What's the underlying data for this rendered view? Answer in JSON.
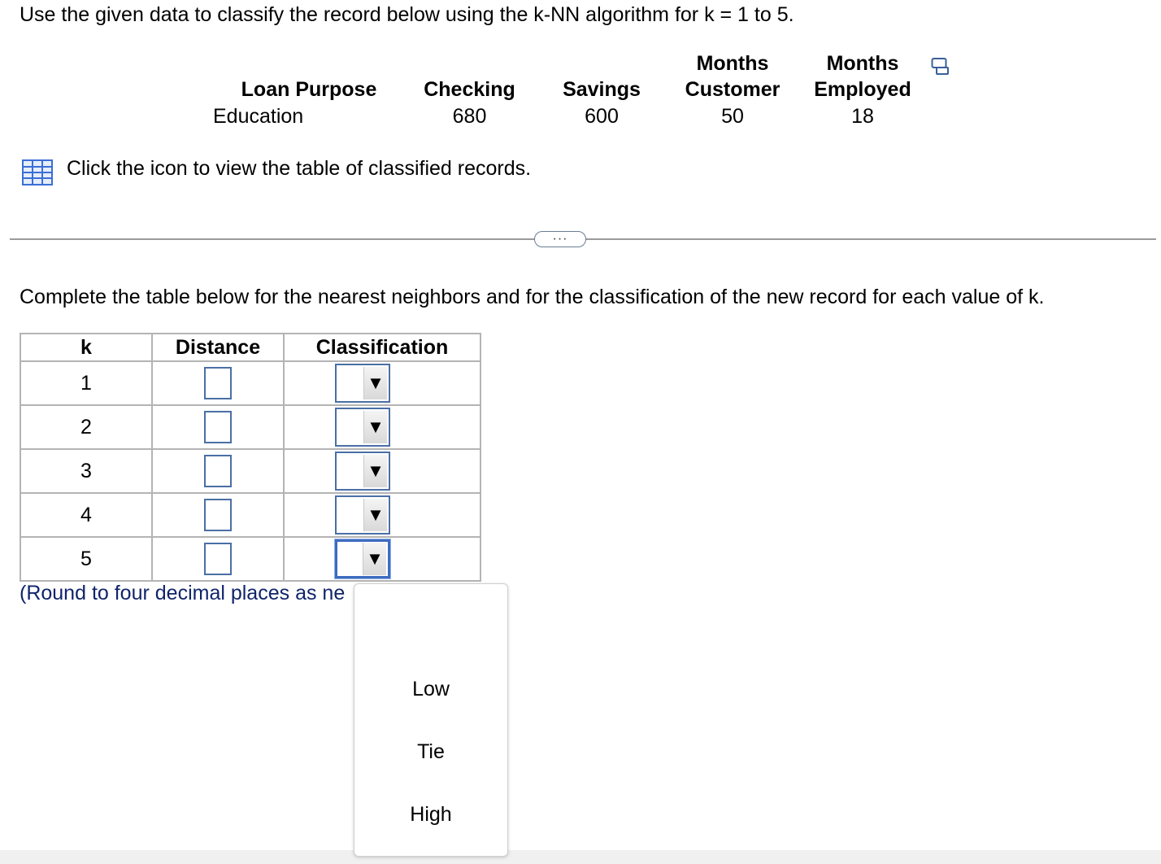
{
  "instruction": "Use the given data to classify the record below using the k-NN algorithm for k = 1 to 5.",
  "record": {
    "columns": [
      {
        "header_top": "",
        "header": "Loan Purpose",
        "value": "Education"
      },
      {
        "header_top": "",
        "header": "Checking",
        "value": "680"
      },
      {
        "header_top": "",
        "header": "Savings",
        "value": "600"
      },
      {
        "header_top": "Months",
        "header": "Customer",
        "value": "50"
      },
      {
        "header_top": "Months",
        "header": "Employed",
        "value": "18"
      }
    ],
    "copy_icon": "copy-data-icon"
  },
  "table_link": {
    "icon": "grid-table-icon",
    "text": "Click the icon to view the table of classified records."
  },
  "expand_button": "···",
  "complete_text": "Complete the table below for the nearest neighbors and for the classification of the new record for each value of k.",
  "answer_table": {
    "headers": [
      "k",
      "Distance",
      "Classification"
    ],
    "rows": [
      {
        "k": "1"
      },
      {
        "k": "2"
      },
      {
        "k": "3"
      },
      {
        "k": "4"
      },
      {
        "k": "5"
      }
    ],
    "dropdown_arrow": "▼",
    "active_row": 5
  },
  "round_note": "(Round to four decimal places as ne",
  "dropdown_menu": {
    "options": [
      "Low",
      "Tie",
      "High"
    ]
  },
  "colors": {
    "input_border": "#4a6fa5",
    "active_border": "#3d6bc0",
    "note_text": "#10246b",
    "table_border": "#b4b4b4"
  }
}
